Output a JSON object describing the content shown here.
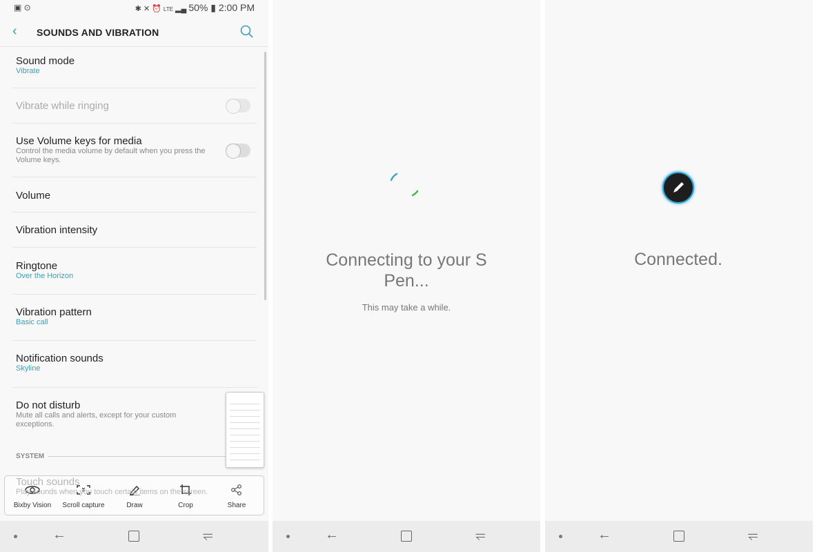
{
  "status_bar": {
    "battery": "50%",
    "time": "2:00 PM",
    "network": "LTE"
  },
  "settings": {
    "title": "SOUNDS AND VIBRATION",
    "rows": [
      {
        "title": "Sound mode",
        "subtitle": "Vibrate"
      },
      {
        "title": "Vibrate while ringing"
      },
      {
        "title": "Use Volume keys for media",
        "description": "Control the media volume by default when you press the Volume keys."
      },
      {
        "title": "Volume"
      },
      {
        "title": "Vibration intensity"
      },
      {
        "title": "Ringtone",
        "subtitle": "Over the Horizon"
      },
      {
        "title": "Vibration pattern",
        "subtitle": "Basic call"
      },
      {
        "title": "Notification sounds",
        "subtitle": "Skyline"
      },
      {
        "title": "Do not disturb",
        "description": "Mute all calls and alerts, except for your custom exceptions."
      }
    ],
    "section": "SYSTEM",
    "touch_sounds": {
      "title": "Touch sounds",
      "description": "Play sounds when you touch certain items on the screen."
    },
    "toggles": {
      "vibrate_while_ringing": false,
      "volume_keys_for_media": false
    }
  },
  "capture_toolbar": [
    {
      "label": "Bixby Vision",
      "icon": "eye-icon"
    },
    {
      "label": "Scroll capture",
      "icon": "scroll-capture-icon"
    },
    {
      "label": "Draw",
      "icon": "pencil-icon"
    },
    {
      "label": "Crop",
      "icon": "crop-icon"
    },
    {
      "label": "Share",
      "icon": "share-icon"
    }
  ],
  "connecting": {
    "title": "Connecting to your S Pen...",
    "subtitle": "This may take a while."
  },
  "connected": {
    "title": "Connected."
  },
  "colors": {
    "accent": "#3a9fb7",
    "spinner_blue": "#3aa5c4",
    "spinner_green": "#4cb84a",
    "pen_circle": "#1e1e1e"
  }
}
